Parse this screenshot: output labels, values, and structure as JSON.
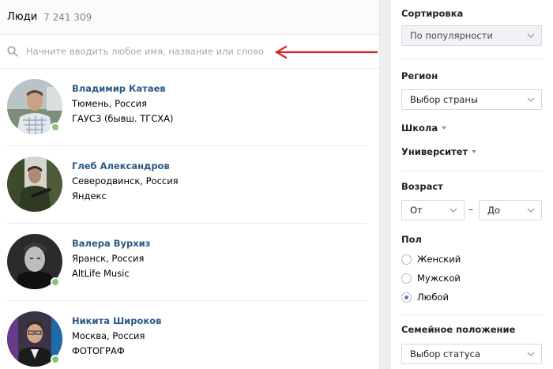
{
  "header": {
    "title": "Люди",
    "count": "7 241 309"
  },
  "search": {
    "placeholder": "Начните вводить любое имя, название или слово"
  },
  "people": [
    {
      "name": "Владимир Катаев",
      "location": "Тюмень, Россия",
      "extra": "ГАУСЗ (бывш. ТГСХА)",
      "online": true
    },
    {
      "name": "Глеб Александров",
      "location": "Северодвинск, Россия",
      "extra": "Яндекс",
      "online": false
    },
    {
      "name": "Валера Вурхиз",
      "location": "Яранск, Россия",
      "extra": "AltLife Music",
      "online": true
    },
    {
      "name": "Никита Широков",
      "location": "Москва, Россия",
      "extra": "ФОТОГРАФ",
      "online": true
    }
  ],
  "filters": {
    "sort": {
      "label": "Сортировка",
      "value": "По популярности"
    },
    "region": {
      "label": "Регион",
      "value": "Выбор страны"
    },
    "school": {
      "label": "Школа"
    },
    "university": {
      "label": "Университет"
    },
    "age": {
      "label": "Возраст",
      "from": "От",
      "to": "До",
      "separator": "–"
    },
    "gender": {
      "label": "Пол",
      "options": [
        "Женский",
        "Мужской",
        "Любой"
      ],
      "selected": "Любой"
    },
    "family": {
      "label": "Семейное положение",
      "value": "Выбор статуса"
    }
  },
  "colors": {
    "link": "#2a5885",
    "online": "#8ac176",
    "arrow": "#d9232a",
    "radio": "#5181b8"
  }
}
